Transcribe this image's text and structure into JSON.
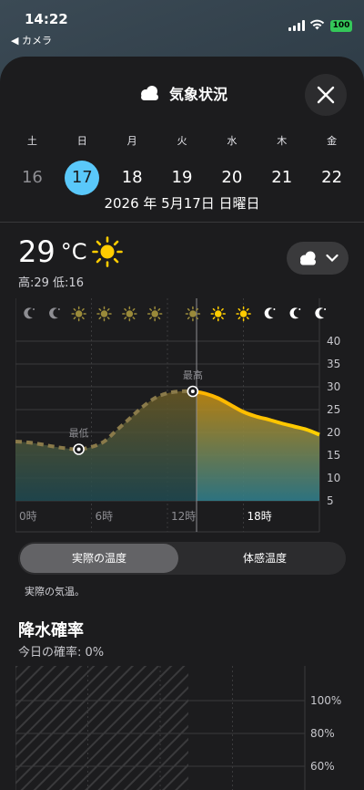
{
  "status": {
    "time": "14:22",
    "back_label": "◀ カメラ",
    "battery": "100"
  },
  "header": {
    "title": "気象状況",
    "close_icon": "close-icon",
    "title_icon": "cloud-icon"
  },
  "days": [
    {
      "dow": "土",
      "num": "16",
      "state": "past"
    },
    {
      "dow": "日",
      "num": "17",
      "state": "selected"
    },
    {
      "dow": "月",
      "num": "18",
      "state": "future"
    },
    {
      "dow": "火",
      "num": "19",
      "state": "future"
    },
    {
      "dow": "水",
      "num": "20",
      "state": "future"
    },
    {
      "dow": "木",
      "num": "21",
      "state": "future"
    },
    {
      "dow": "金",
      "num": "22",
      "state": "future"
    }
  ],
  "full_date": "2026 年 5月17日 日曜日",
  "current": {
    "temp": "29",
    "unit": "°C",
    "hilo": "高:29 低:16",
    "icon": "sun-icon"
  },
  "condition_button": {
    "icon": "cloud-icon",
    "chevron": "chevron-down-icon"
  },
  "chart_data": {
    "type": "area",
    "title": "",
    "x_ticks": [
      "0時",
      "6時",
      "12時",
      "18時"
    ],
    "y_ticks": [
      "40",
      "35",
      "30",
      "25",
      "20",
      "15",
      "10",
      "5"
    ],
    "ylim": [
      5,
      43
    ],
    "xlim": [
      0,
      24
    ],
    "hour_icons": [
      "moon",
      "moon",
      "sun",
      "sun",
      "sun",
      "sun",
      "sun",
      "sun",
      "sun",
      "sun",
      "sun",
      "sun",
      "sun",
      "sun",
      "sun",
      "sun",
      "sun",
      "sun",
      "sun",
      "sun",
      "moon",
      "moon",
      "moon",
      "moon"
    ],
    "hour_icon_hours": [
      0,
      2,
      4,
      6,
      8,
      10,
      13,
      15,
      17,
      19,
      21,
      23
    ],
    "hour_icon_kinds": [
      "moon",
      "moon",
      "sun",
      "sun",
      "sun",
      "sun",
      "sun",
      "sun",
      "sun",
      "moon",
      "moon",
      "moon"
    ],
    "now_hour": 14.3,
    "series": [
      {
        "hours": [
          0,
          1,
          2,
          3,
          4,
          5,
          6,
          7,
          8,
          9,
          10,
          11,
          12,
          13,
          14,
          15,
          16,
          17,
          18,
          19,
          20,
          21,
          22,
          23,
          24
        ],
        "values": [
          18,
          17.8,
          17.4,
          16.9,
          16.5,
          16.3,
          16.8,
          18,
          20.5,
          23,
          25.5,
          27.5,
          28.6,
          29,
          29,
          28.5,
          27.5,
          26,
          24.5,
          23.5,
          22.8,
          22,
          21.3,
          20.6,
          19.5
        ]
      }
    ],
    "annotations": [
      {
        "label": "最低",
        "hour": 5,
        "value": 16.3
      },
      {
        "label": "最高",
        "hour": 14,
        "value": 29
      }
    ]
  },
  "toggle": {
    "active": "実際の温度",
    "inactive": "体感温度"
  },
  "description": "実際の気温。",
  "precip": {
    "title": "降水確率",
    "subtitle": "今日の確率: 0%",
    "y_ticks": [
      "100%",
      "80%",
      "60%"
    ]
  },
  "colors": {
    "accent": "#5ac8fa",
    "sun": "#ffcc00",
    "line_future": "#ffb300",
    "line_past": "#8a7a4a"
  }
}
